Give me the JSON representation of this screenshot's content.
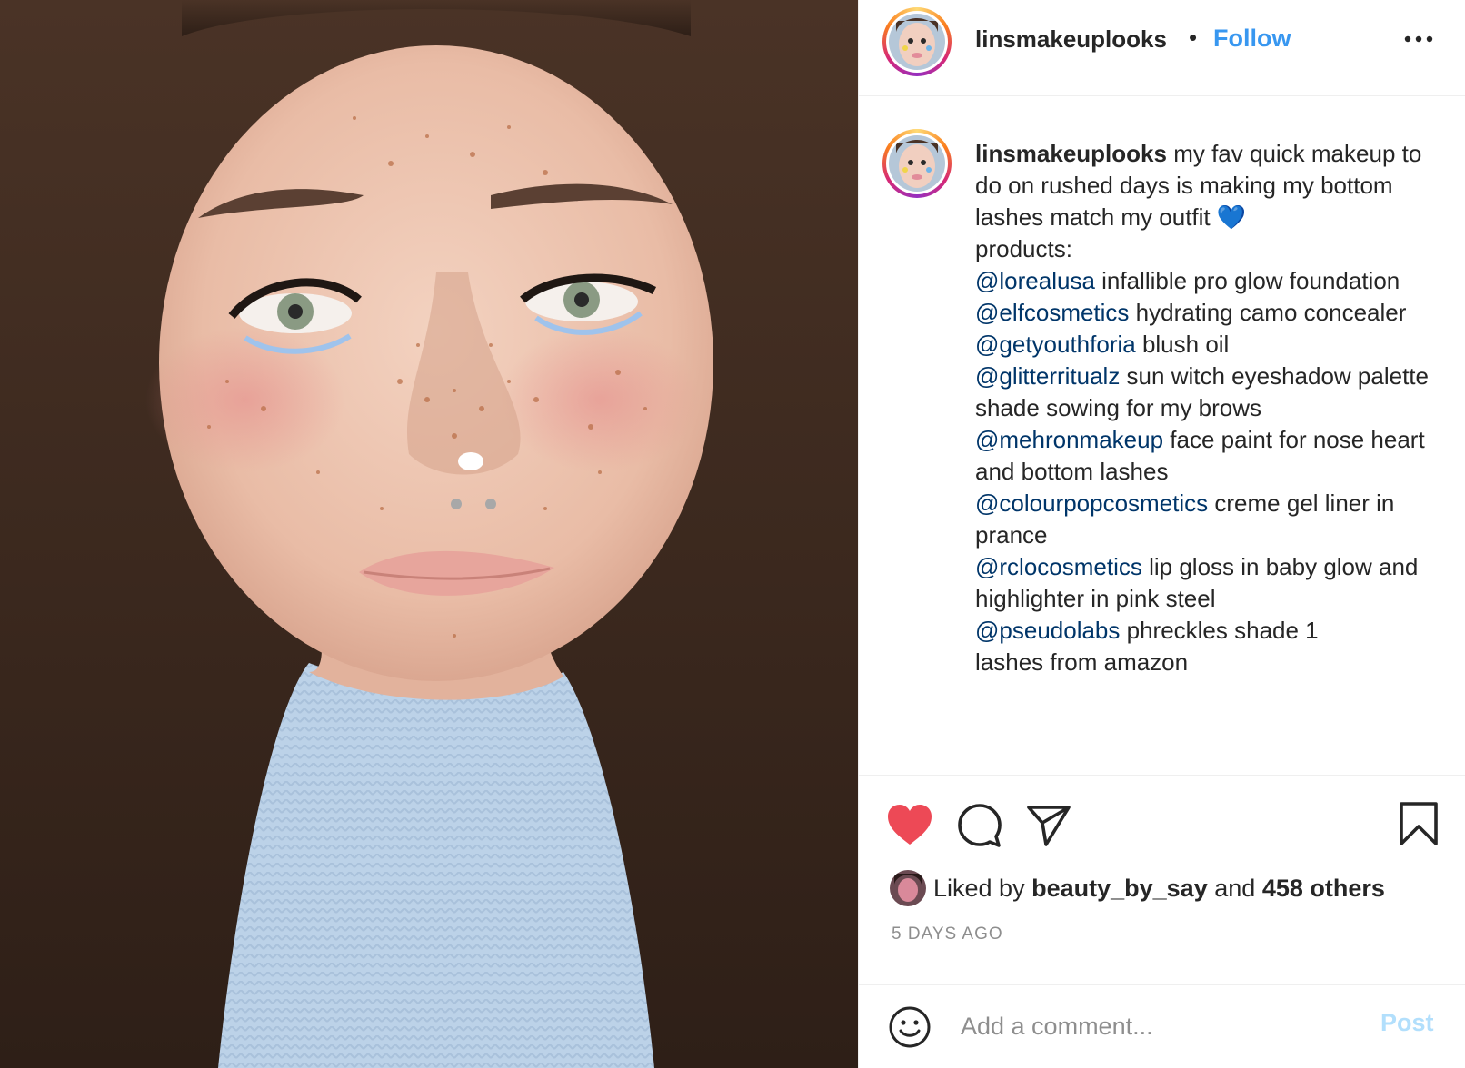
{
  "post": {
    "username": "linsmakeuplooks",
    "separator": "•",
    "follow_label": "Follow",
    "more_label": "More options"
  },
  "caption": {
    "username": "linsmakeuplooks",
    "lines": [
      {
        "mention": "",
        "text": " my fav quick makeup to do on rushed days is making my bottom lashes match my outfit 💙"
      },
      {
        "mention": "",
        "text": "products:"
      },
      {
        "mention": "@lorealusa",
        "text": " infallible pro glow foundation"
      },
      {
        "mention": "@elfcosmetics",
        "text": " hydrating camo concealer"
      },
      {
        "mention": "@getyouthforia",
        "text": " blush oil"
      },
      {
        "mention": "@glitterritualz",
        "text": " sun witch eyeshadow palette shade sowing for my brows"
      },
      {
        "mention": "@mehronmakeup",
        "text": " face paint for nose heart and bottom lashes"
      },
      {
        "mention": "@colourpopcosmetics",
        "text": " creme gel liner in prance"
      },
      {
        "mention": "@rclocosmetics",
        "text": " lip gloss in baby glow and highlighter in pink steel"
      },
      {
        "mention": "@pseudolabs",
        "text": " phreckles shade 1"
      },
      {
        "mention": "",
        "text": "lashes from amazon"
      }
    ]
  },
  "actions": {
    "like_icon": "heart-filled-icon",
    "comment_icon": "comment-icon",
    "share_icon": "paper-plane-icon",
    "save_icon": "bookmark-icon"
  },
  "likes": {
    "prefix": "Liked by",
    "user": "beauty_by_say",
    "middle": "and",
    "others": "458 others"
  },
  "timestamp": "5 DAYS AGO",
  "comment": {
    "placeholder": "Add a comment...",
    "post_label": "Post",
    "emoji_icon": "smiley-icon"
  },
  "colors": {
    "link": "#3897f0",
    "mention": "#003569",
    "like": "#ed4956",
    "muted": "#8e8e8e",
    "post_disabled": "#b2dffc"
  }
}
